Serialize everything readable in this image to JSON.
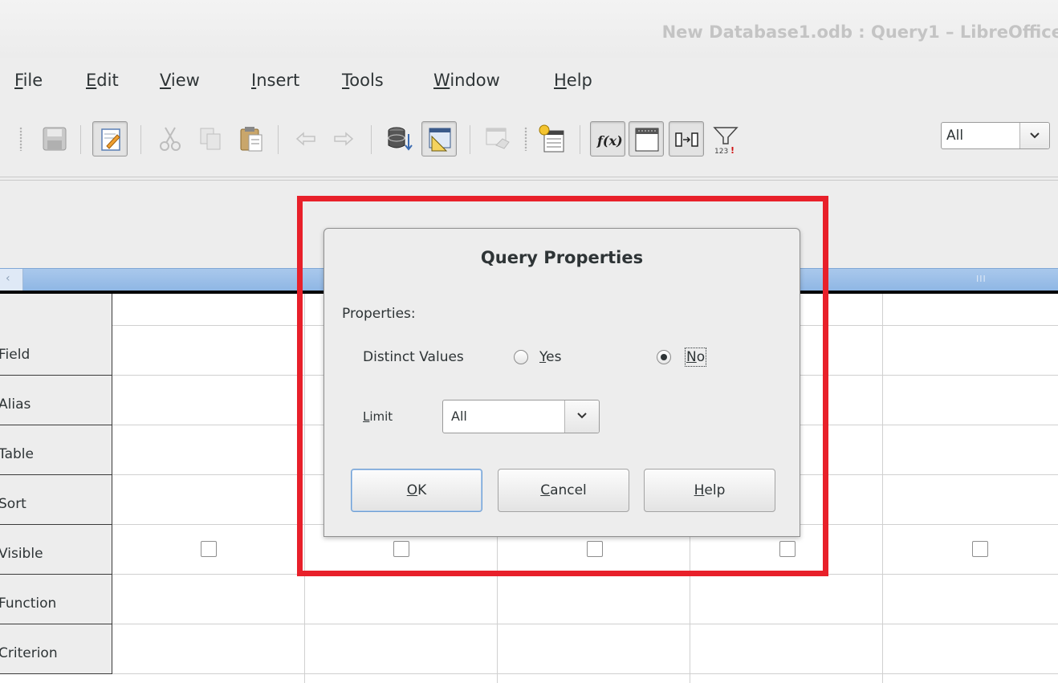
{
  "window": {
    "title": "New Database1.odb : Query1 – LibreOffice"
  },
  "menu": [
    {
      "label": "File",
      "ul": "F",
      "rest": "ile"
    },
    {
      "label": "Edit",
      "ul": "E",
      "rest": "dit"
    },
    {
      "label": "View",
      "ul": "V",
      "rest": "iew"
    },
    {
      "label": "Insert",
      "ul": "I",
      "rest": "nsert"
    },
    {
      "label": "Tools",
      "ul": "T",
      "rest": "ools"
    },
    {
      "label": "Window",
      "ul": "W",
      "rest": "indow"
    },
    {
      "label": "Help",
      "ul": "H",
      "rest": "elp"
    }
  ],
  "toolbar": {
    "limit_value": "All",
    "icons": [
      "save-icon",
      "edit-mode-icon",
      "cut-icon",
      "copy-icon",
      "paste-icon",
      "undo-icon",
      "redo-icon",
      "run-query-icon",
      "design-view-icon",
      "clear-query-icon",
      "add-table-icon",
      "functions-icon",
      "table-name-icon",
      "alias-icon",
      "distinct-values-icon"
    ]
  },
  "grid": {
    "rows": [
      "Field",
      "Alias",
      "Table",
      "Sort",
      "Visible",
      "Function",
      "Criterion"
    ]
  },
  "dialog": {
    "title": "Query Properties",
    "properties_label": "Properties:",
    "distinct_label": "Distinct Values",
    "yes_ul": "Y",
    "yes_rest": "es",
    "no_ul": "N",
    "no_rest": "o",
    "distinct_selected": "No",
    "limit_ul": "L",
    "limit_rest": "imit",
    "limit_value": "All",
    "ok_ul": "O",
    "ok_rest": "K",
    "cancel_ul": "C",
    "cancel_rest": "ancel",
    "help_ul": "H",
    "help_rest": "elp"
  },
  "colors": {
    "highlight": "#e8202a",
    "scrollbar": "#9ebfe8"
  }
}
